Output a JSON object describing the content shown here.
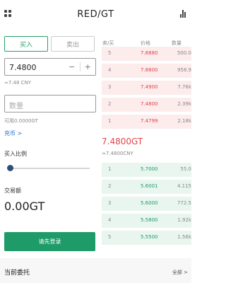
{
  "header": {
    "title": "RED/GT"
  },
  "tabs": {
    "buy": "买入",
    "sell": "卖出"
  },
  "price_input": {
    "value": "7.4800",
    "minus": "−",
    "plus": "+",
    "cny": "≈7.48 CNY"
  },
  "quantity_input": {
    "placeholder": "数量",
    "available": "可用0.0000GT"
  },
  "recharge": "充币 >",
  "ratio": {
    "label": "买入比例",
    "percent": 0
  },
  "volume": {
    "label": "交易额",
    "value": "0.00GT"
  },
  "login_button": "请先登录",
  "orders": {
    "title": "当前委托",
    "all": "全部 >"
  },
  "orderbook": {
    "headers": {
      "side": "卖/买",
      "price": "价格",
      "amount": "数量"
    },
    "asks": [
      {
        "idx": "5",
        "price": "7.8880",
        "amount": "500.0"
      },
      {
        "idx": "4",
        "price": "7.8800",
        "amount": "958.9"
      },
      {
        "idx": "3",
        "price": "7.4900",
        "amount": "7.76k"
      },
      {
        "idx": "2",
        "price": "7.4800",
        "amount": "2.39k"
      },
      {
        "idx": "1",
        "price": "7.4799",
        "amount": "2.18k"
      }
    ],
    "last_price": "7.4800GT",
    "last_cny": "≈7.4800CNY",
    "bids": [
      {
        "idx": "1",
        "price": "5.7000",
        "amount": "55.0"
      },
      {
        "idx": "2",
        "price": "5.6001",
        "amount": "4.115"
      },
      {
        "idx": "3",
        "price": "5.6000",
        "amount": "772.5"
      },
      {
        "idx": "4",
        "price": "5.5800",
        "amount": "1.92k"
      },
      {
        "idx": "5",
        "price": "5.5500",
        "amount": "1.56k"
      }
    ]
  },
  "colors": {
    "green": "#1e9b68",
    "red": "#e0464c",
    "link": "#2f6fc8"
  },
  "icons": {
    "menu": "grid-menu-icon",
    "chart": "bar-chart-icon"
  }
}
